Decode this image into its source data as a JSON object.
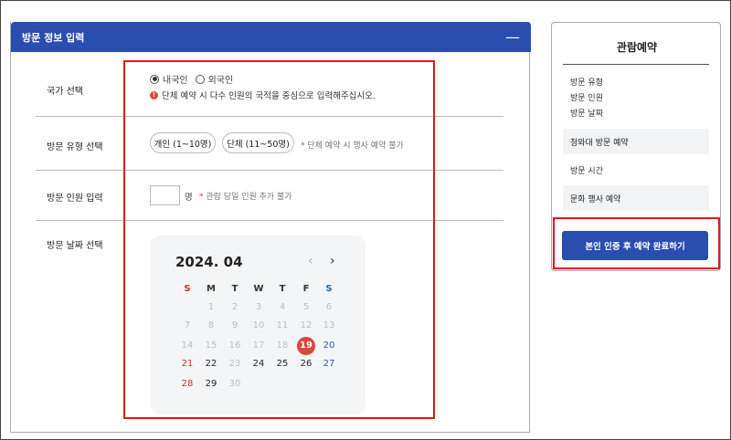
{
  "form": {
    "title": "방문 정보 입력",
    "collapse_symbol": "—",
    "country_label": "국가 선택",
    "country_options": [
      "내국인",
      "외국인"
    ],
    "country_notice": "단체 예약 시 다수 인원의 국적을 중심으로 입력해주십시오.",
    "type_label": "방문 유형 선택",
    "type_individual": "개인 (1~10명)",
    "type_group": "단체 (11~50명)",
    "type_hint": "단체 예약 시 행사 예약 불가",
    "count_label": "방문 인원 입력",
    "count_unit": "명",
    "count_hint": "관람 당일 인원 추가 불가",
    "date_label": "방문 날짜 선택",
    "hint_star": "*",
    "warn_glyph": "!"
  },
  "calendar": {
    "month": "2024. 04",
    "prev": "‹",
    "next": "›",
    "weekdays": [
      "S",
      "M",
      "T",
      "W",
      "T",
      "F",
      "S"
    ],
    "selected_day": "19",
    "days": [
      [
        "",
        "1",
        "2",
        "3",
        "4",
        "5",
        "6"
      ],
      [
        "7",
        "8",
        "9",
        "10",
        "11",
        "12",
        "13"
      ],
      [
        "14",
        "15",
        "16",
        "17",
        "18",
        "19",
        "20"
      ],
      [
        "21",
        "22",
        "23",
        "24",
        "25",
        "26",
        "27"
      ],
      [
        "28",
        "29",
        "30",
        "",
        "",
        "",
        ""
      ]
    ]
  },
  "sidebar": {
    "title": "관람예약",
    "items": [
      "방문 유형",
      "방문 인원",
      "방문 날짜"
    ],
    "band_reservation": "청와대 방문 예약",
    "visit_time": "방문 시간",
    "band_event": "문화 행사 예약",
    "cta": "본인 인증 후 예약 완료하기"
  },
  "colors": {
    "primary": "#2a4db0",
    "sunday": "#c9302c",
    "saturday": "#2a62b8",
    "selected": "#d9483b",
    "disabled": "#bdbdbd",
    "highlight": "#e8141b"
  }
}
